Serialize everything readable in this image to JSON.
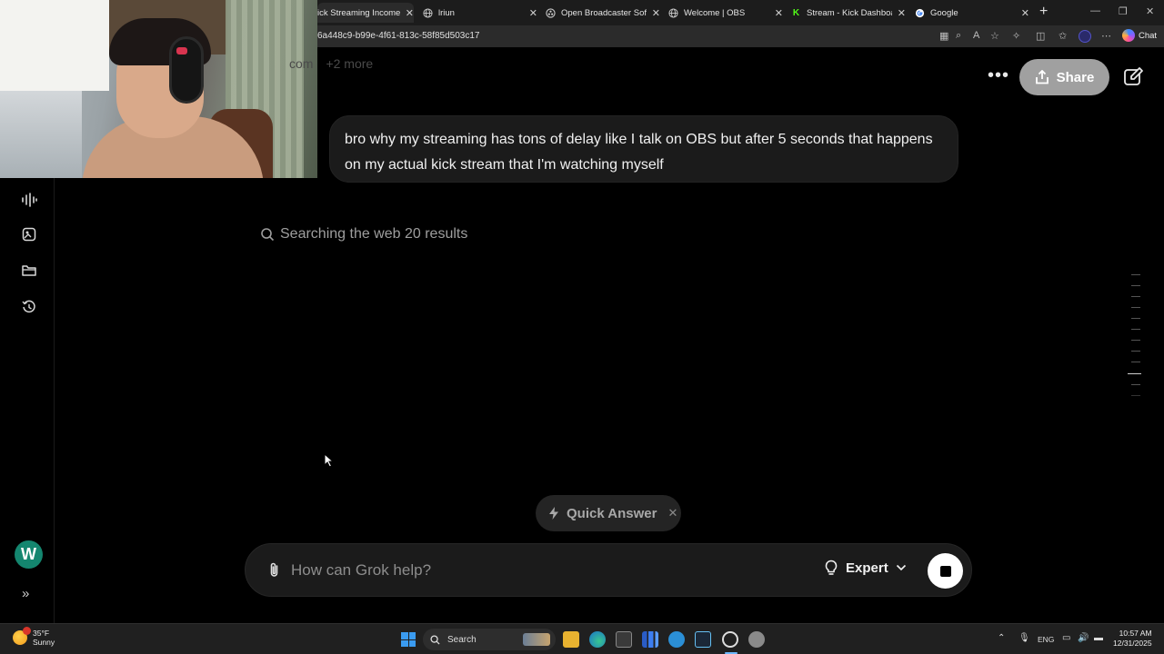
{
  "browser": {
    "tabs": [
      {
        "label": "ick Streaming Income: Foll",
        "active": true
      },
      {
        "label": "lriun",
        "active": false
      },
      {
        "label": "Open Broadcaster Software",
        "active": false
      },
      {
        "label": "Welcome | OBS",
        "active": false
      },
      {
        "label": "Stream - Kick Dashboard",
        "active": false
      },
      {
        "label": "Google",
        "active": false
      }
    ],
    "url": "6a448c9-b99e-4f61-813c-58f85d503c17",
    "chat_label": "Chat"
  },
  "header": {
    "sources_prefix": "com",
    "sources_more": "+2 more",
    "share_label": "Share"
  },
  "conversation": {
    "user_message": "bro why my streaming has tons of delay like I talk on OBS but after 5 seconds that happens on my actual kick stream that I'm watching myself",
    "status": "Searching the web 20 results"
  },
  "composer": {
    "quick_answer_label": "Quick Answer",
    "placeholder": "How can Grok help?",
    "mode_label": "Expert"
  },
  "sidebar": {
    "avatar_letter": "W"
  },
  "taskbar": {
    "weather_temp": "35°F",
    "weather_desc": "Sunny",
    "search_label": "Search",
    "lang": "ENG",
    "time": "10:57 AM",
    "date": "12/31/2025"
  },
  "colors": {
    "background": "#000000",
    "bubble": "#1b1b1b",
    "share_button": "#a0a0a0",
    "avatar": "#14866f"
  }
}
